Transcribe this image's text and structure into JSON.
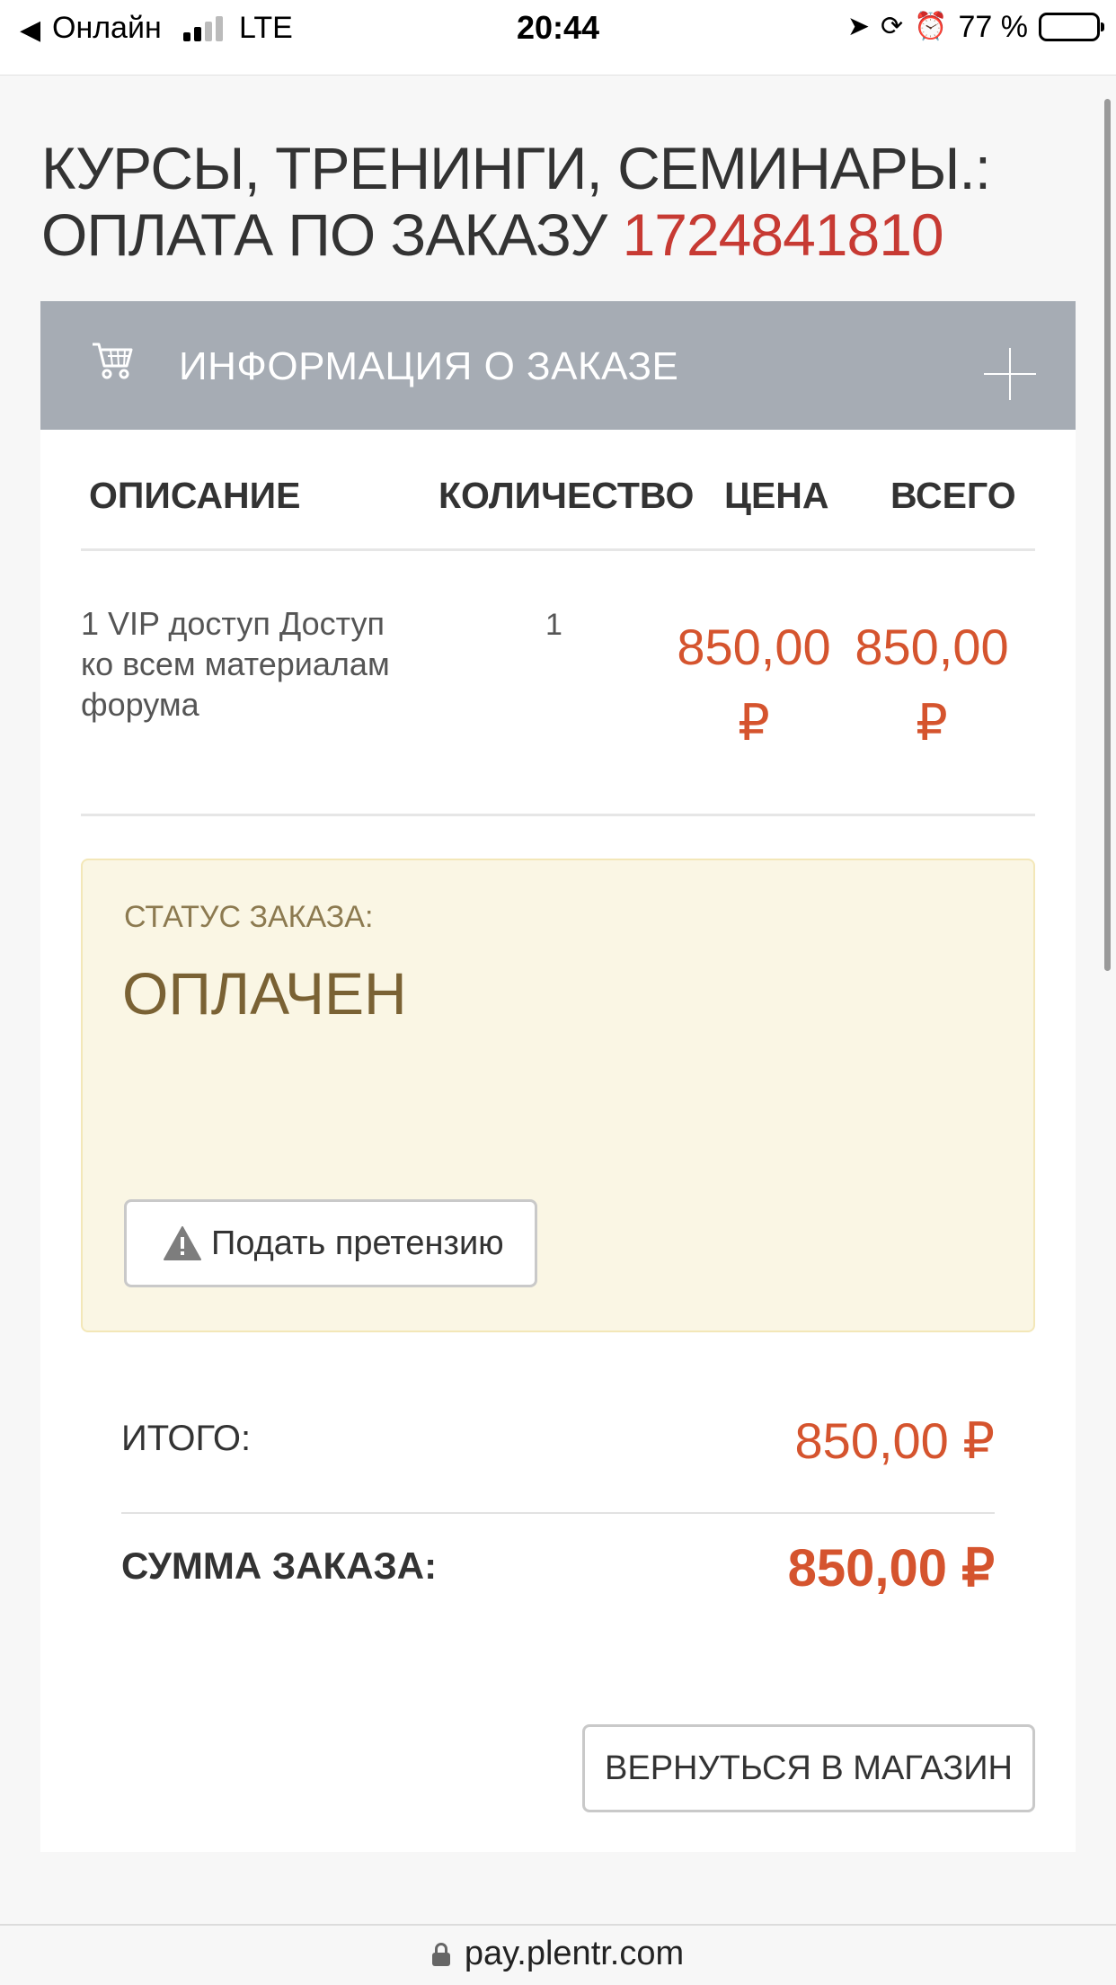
{
  "status_bar": {
    "back_indicator": "◀",
    "carrier": "Онлайн",
    "network": "LTE",
    "time": "20:44",
    "battery": "77 %",
    "battery_level": 0.77,
    "signal_bars_active": 2,
    "icons": [
      "location-arrow-icon",
      "rotation-lock-icon",
      "alarm-icon",
      "battery-icon"
    ]
  },
  "page": {
    "title_line1": "КУРСЫ, ТРЕНИНГИ, СЕМИНАРЫ.:",
    "title_line2_prefix": "ОПЛАТА ПО ЗАКАЗУ",
    "order_number": "1724841810"
  },
  "order_info": {
    "heading": "ИНФОРМАЦИЯ О ЗАКАЗЕ",
    "expand_icon": "plus-icon",
    "cart_icon": "cart-icon"
  },
  "table": {
    "headers": [
      "ОПИСАНИЕ",
      "КОЛИЧЕСТВО",
      "ЦЕНА",
      "ВСЕГО"
    ],
    "rows": [
      {
        "description": "1 VIP доступ Доступ ко всем материалам форума",
        "quantity": "1",
        "price": "850,00 ₽",
        "total": "850,00 ₽"
      }
    ]
  },
  "status": {
    "label": "СТАТУС ЗАКАЗА:",
    "value": "ОПЛАЧЕН",
    "claim_button": "Подать претензию"
  },
  "totals": {
    "subtotal_label": "ИТОГО:",
    "subtotal_value": "850,00 ₽",
    "sum_label": "СУММА ЗАКАЗА:",
    "sum_value": "850,00 ₽"
  },
  "actions": {
    "back_to_shop": "ВЕРНУТЬСЯ В МАГАЗИН"
  },
  "browser": {
    "url": "pay.plentr.com"
  },
  "colors": {
    "accent_red": "#d5542e",
    "order_number": "#c73a33",
    "info_bar": "#a6acb4",
    "status_bg": "#faf6e4",
    "status_text": "#7a6234"
  }
}
